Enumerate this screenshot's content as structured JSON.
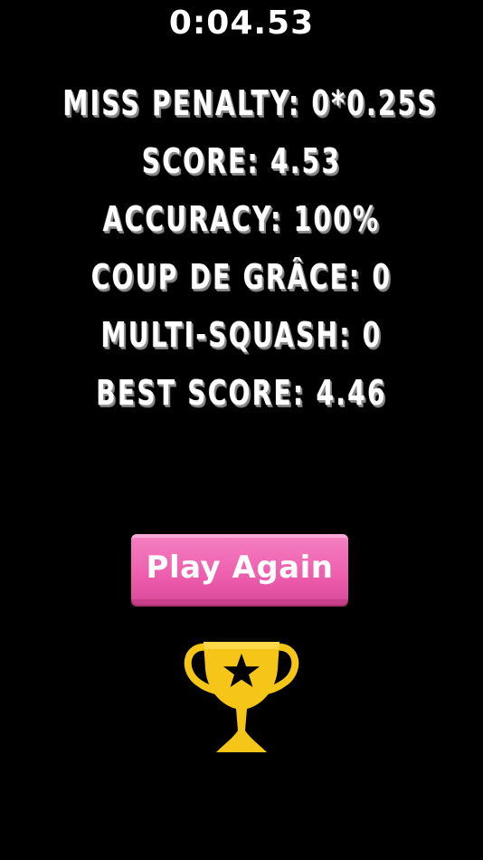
{
  "hud": {
    "timer": "0:04.53"
  },
  "results": {
    "miss_penalty": {
      "label": "MISS PENALTY:",
      "value": "0*0.25S"
    },
    "score": {
      "label": "SCORE:",
      "value": "4.53"
    },
    "accuracy": {
      "label": "ACCURACY:",
      "value": "100%"
    },
    "coup_de_grace": {
      "label": "COUP DE GRÂCE:",
      "value": "0"
    },
    "multi_squash": {
      "label": "MULTI-SQUASH:",
      "value": "0"
    },
    "best_score": {
      "label": "BEST SCORE:",
      "value": "4.46"
    }
  },
  "actions": {
    "play_again_label": "Play Again"
  },
  "icons": {
    "trophy": "trophy-icon",
    "star": "star-icon"
  },
  "colors": {
    "background": "#000000",
    "text": "#ffffff",
    "button": "#ee5fae",
    "trophy_gold": "#f5c518",
    "star": "#000000"
  }
}
